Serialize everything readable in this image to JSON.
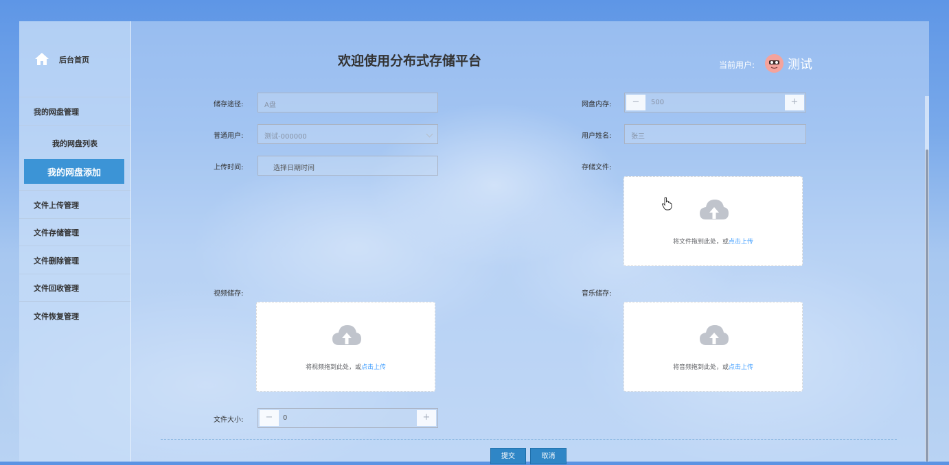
{
  "sidebar": {
    "home_label": "后台首页",
    "items": [
      {
        "label": "我的网盘管理"
      },
      {
        "label": "我的网盘列表"
      },
      {
        "label": "我的网盘添加"
      },
      {
        "label": "文件上传管理"
      },
      {
        "label": "文件存储管理"
      },
      {
        "label": "文件删除管理"
      },
      {
        "label": "文件回收管理"
      },
      {
        "label": "文件恢复管理"
      }
    ]
  },
  "header": {
    "title": "欢迎使用分布式存储平台",
    "current_user_label": "当前用户:",
    "user_name": "测试"
  },
  "form": {
    "storage_path": {
      "label": "储存途径:",
      "value": "A盘"
    },
    "disk_memory": {
      "label": "网盘内存:",
      "value": "500",
      "minus": "−",
      "plus": "+"
    },
    "normal_user": {
      "label": "普通用户:",
      "value": "测试-000000"
    },
    "user_realname": {
      "label": "用户姓名:",
      "value": "张三"
    },
    "upload_time": {
      "label": "上传时间:",
      "placeholder": "选择日期时间"
    },
    "storage_file": {
      "label": "存储文件:",
      "hint": "将文件拖到此处，或",
      "link": "点击上传"
    },
    "video_storage": {
      "label": "视频储存:",
      "hint": "将视频拖到此处，或",
      "link": "点击上传"
    },
    "music_storage": {
      "label": "音乐储存:",
      "hint": "将音频拖到此处，或",
      "link": "点击上传"
    },
    "file_size": {
      "label": "文件大小:",
      "value": "0",
      "minus": "−",
      "plus": "+"
    }
  },
  "actions": {
    "submit": "提交",
    "cancel": "取消"
  },
  "colors": {
    "accent": "#3c94d6",
    "link": "#409eff",
    "button": "#2f86c6"
  }
}
